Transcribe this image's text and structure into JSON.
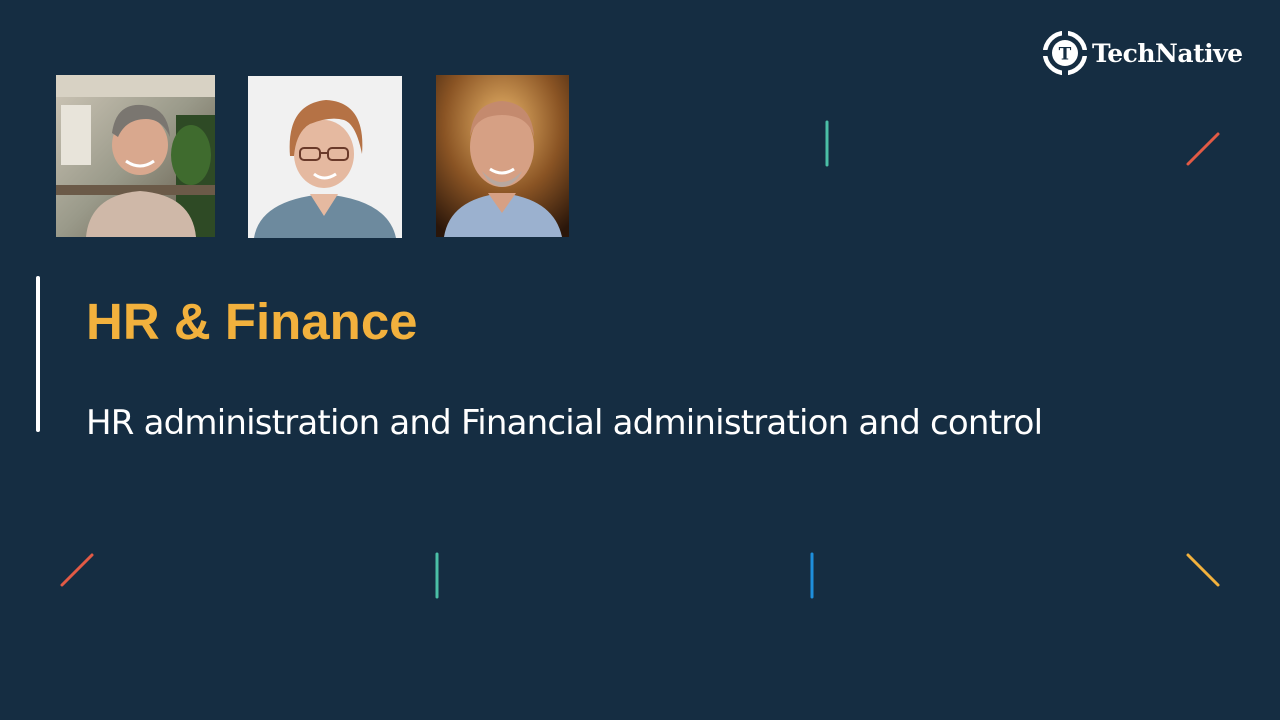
{
  "brand": {
    "name": "TechNative",
    "logo_letter": "T",
    "logo_color": "#ffffff"
  },
  "slide": {
    "title": "HR & Finance",
    "subtitle": "HR administration and Financial administration and control",
    "background_color": "#152d42",
    "title_color": "#f2b13d",
    "text_color": "#ffffff"
  },
  "photos": [
    {
      "id": "photo-1",
      "icon": "portrait-photo"
    },
    {
      "id": "photo-2",
      "icon": "portrait-photo"
    },
    {
      "id": "photo-3",
      "icon": "portrait-photo"
    }
  ],
  "decorations": {
    "colors": [
      "#e25a45",
      "#4bbfa6",
      "#1e8fdc",
      "#f2b13d"
    ]
  }
}
